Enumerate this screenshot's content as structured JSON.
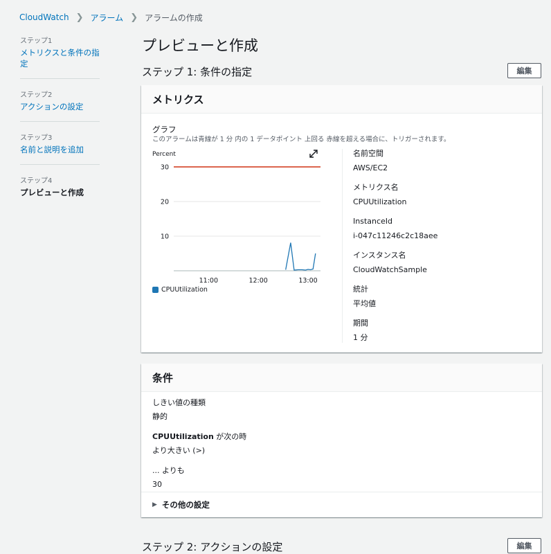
{
  "breadcrumb": {
    "items": [
      "CloudWatch",
      "アラーム"
    ],
    "current": "アラームの作成"
  },
  "steps": [
    {
      "num": "ステップ1",
      "label": "メトリクスと条件の指定"
    },
    {
      "num": "ステップ2",
      "label": "アクションの設定"
    },
    {
      "num": "ステップ3",
      "label": "名前と説明を追加"
    },
    {
      "num": "ステップ4",
      "label": "プレビューと作成"
    }
  ],
  "page_title": "プレビューと作成",
  "step1_title": "ステップ 1: 条件の指定",
  "step2_title": "ステップ 2: アクションの設定",
  "edit_label": "編集",
  "metrics_panel": {
    "title": "メトリクス",
    "graph_label": "グラフ",
    "graph_desc": "このアラームは青線が 1 分 内の 1 データポイント 上回る 赤線を超える場合に、トリガーされます。",
    "details": [
      {
        "key": "名前空間",
        "value": "AWS/EC2"
      },
      {
        "key": "メトリクス名",
        "value": "CPUUtilization"
      },
      {
        "key": "InstanceId",
        "value": "i-047c11246c2c18aee"
      },
      {
        "key": "インスタンス名",
        "value": "CloudWatchSample"
      },
      {
        "key": "統計",
        "value": "平均値"
      },
      {
        "key": "期間",
        "value": "1 分"
      }
    ]
  },
  "chart_data": {
    "type": "line",
    "ylabel": "Percent",
    "ylim": [
      0,
      30
    ],
    "yticks": [
      10,
      20,
      30
    ],
    "xlim": [
      10.3,
      13.25
    ],
    "xticks": [
      {
        "value": 11.0,
        "label": "11:00"
      },
      {
        "value": 12.0,
        "label": "12:00"
      },
      {
        "value": 13.0,
        "label": "13:00"
      }
    ],
    "threshold": {
      "value": 30,
      "color": "#d13212"
    },
    "series": [
      {
        "name": "CPUUtilization",
        "color": "#1f77b4",
        "x": [
          12.55,
          12.65,
          12.72,
          12.8,
          12.88,
          12.95,
          13.0,
          13.05,
          13.1,
          13.15
        ],
        "y": [
          0.3,
          8.1,
          0.2,
          0.3,
          0.3,
          0.2,
          0.4,
          0.3,
          0.5,
          5.0
        ]
      }
    ],
    "grid": true,
    "legend": "bottom-left",
    "expand_icon": "expand-icon"
  },
  "conditions_panel": {
    "title": "条件",
    "items": [
      {
        "key": "しきい値の種類",
        "value": "静的"
      },
      {
        "key_bold": "CPUUtilization",
        "key_rest": " が次の時",
        "value": "より大きい (>)"
      },
      {
        "key": "... よりも",
        "value": "30"
      }
    ],
    "more_settings": "その他の設定"
  }
}
